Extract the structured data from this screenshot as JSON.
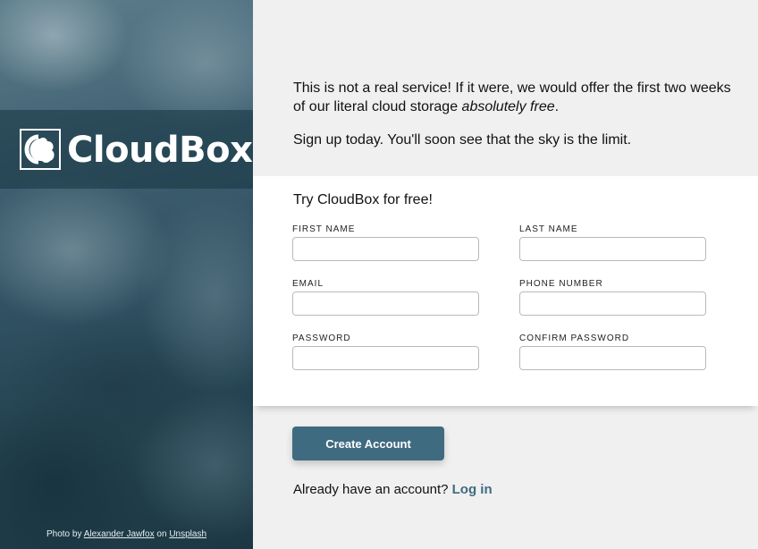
{
  "hero": {
    "brand_name": "CloudBox",
    "logo_icon": "cloudbox-logo-icon",
    "credit": {
      "prefix": "Photo by",
      "author": "Alexander Jawfox",
      "middle": "on",
      "site": "Unsplash"
    }
  },
  "intro": {
    "line1_prefix": "This is not a real service! If it were, we would offer the first two weeks of our literal cloud storage ",
    "line1_emphasis": "absolutely free",
    "line1_suffix": ".",
    "line2": "Sign up today. You'll soon see that the sky is the limit."
  },
  "form": {
    "title": "Try CloudBox for free!",
    "fields": {
      "first_name": {
        "label": "FIRST NAME",
        "value": ""
      },
      "last_name": {
        "label": "LAST NAME",
        "value": ""
      },
      "email": {
        "label": "EMAIL",
        "value": ""
      },
      "phone": {
        "label": "PHONE NUMBER",
        "value": ""
      },
      "password": {
        "label": "PASSWORD",
        "value": ""
      },
      "confirm_password": {
        "label": "CONFIRM PASSWORD",
        "value": ""
      }
    }
  },
  "actions": {
    "create_label": "Create Account",
    "login_prompt": "Already have an account?",
    "login_link": "Log in"
  },
  "colors": {
    "accent": "#3f6b80",
    "page_bg": "#f0f0f0",
    "card_bg": "#ffffff"
  }
}
